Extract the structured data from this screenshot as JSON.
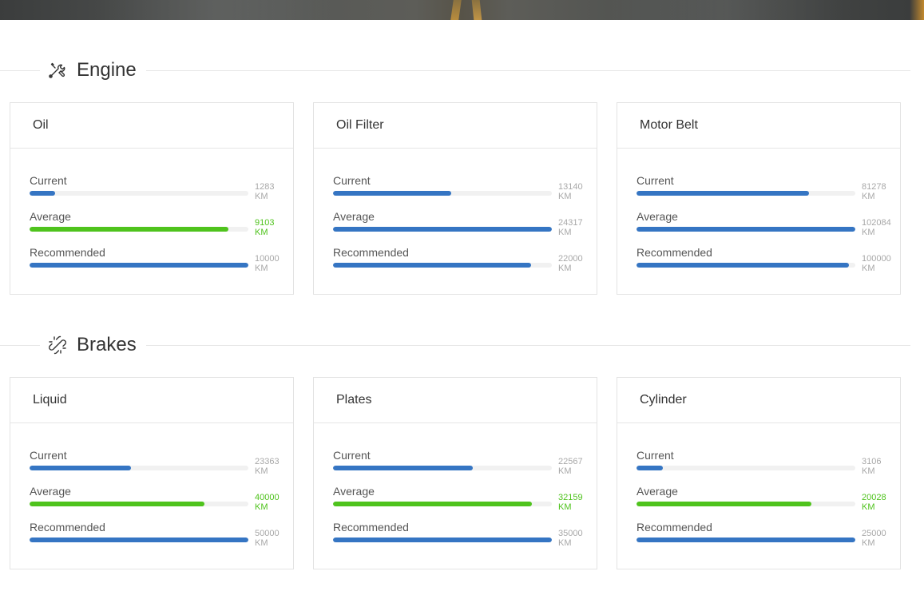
{
  "sections": [
    {
      "title": "Engine",
      "icon": "wrench-icon",
      "cards": [
        {
          "title": "Oil",
          "metrics": [
            {
              "label": "Current",
              "value": "1283",
              "unit": "KM",
              "fraction": 0.117,
              "color": "blue"
            },
            {
              "label": "Average",
              "value": "9103",
              "unit": "KM",
              "fraction": 0.91,
              "color": "green"
            },
            {
              "label": "Recommended",
              "value": "10000",
              "unit": "KM",
              "fraction": 1.0,
              "color": "blue"
            }
          ]
        },
        {
          "title": "Oil Filter",
          "metrics": [
            {
              "label": "Current",
              "value": "13140",
              "unit": "KM",
              "fraction": 0.54,
              "color": "blue"
            },
            {
              "label": "Average",
              "value": "24317",
              "unit": "KM",
              "fraction": 1.0,
              "color": "blue"
            },
            {
              "label": "Recommended",
              "value": "22000",
              "unit": "KM",
              "fraction": 0.905,
              "color": "blue"
            }
          ]
        },
        {
          "title": "Motor Belt",
          "metrics": [
            {
              "label": "Current",
              "value": "81278",
              "unit": "KM",
              "fraction": 0.79,
              "color": "blue"
            },
            {
              "label": "Average",
              "value": "102084",
              "unit": "KM",
              "fraction": 1.0,
              "color": "blue"
            },
            {
              "label": "Recommended",
              "value": "100000",
              "unit": "KM",
              "fraction": 0.97,
              "color": "blue"
            }
          ]
        }
      ]
    },
    {
      "title": "Brakes",
      "icon": "broken-link-icon",
      "cards": [
        {
          "title": "Liquid",
          "metrics": [
            {
              "label": "Current",
              "value": "23363",
              "unit": "KM",
              "fraction": 0.465,
              "color": "blue"
            },
            {
              "label": "Average",
              "value": "40000",
              "unit": "KM",
              "fraction": 0.8,
              "color": "green"
            },
            {
              "label": "Recommended",
              "value": "50000",
              "unit": "KM",
              "fraction": 1.0,
              "color": "blue"
            }
          ]
        },
        {
          "title": "Plates",
          "metrics": [
            {
              "label": "Current",
              "value": "22567",
              "unit": "KM",
              "fraction": 0.64,
              "color": "blue"
            },
            {
              "label": "Average",
              "value": "32159",
              "unit": "KM",
              "fraction": 0.91,
              "color": "green"
            },
            {
              "label": "Recommended",
              "value": "35000",
              "unit": "KM",
              "fraction": 1.0,
              "color": "blue"
            }
          ]
        },
        {
          "title": "Cylinder",
          "metrics": [
            {
              "label": "Current",
              "value": "3106",
              "unit": "KM",
              "fraction": 0.12,
              "color": "blue"
            },
            {
              "label": "Average",
              "value": "20028",
              "unit": "KM",
              "fraction": 0.8,
              "color": "green"
            },
            {
              "label": "Recommended",
              "value": "25000",
              "unit": "KM",
              "fraction": 1.0,
              "color": "blue"
            }
          ]
        }
      ]
    }
  ],
  "colors": {
    "blue": "#3575c3",
    "green": "#4fc31d",
    "track": "#f1f1f1"
  }
}
